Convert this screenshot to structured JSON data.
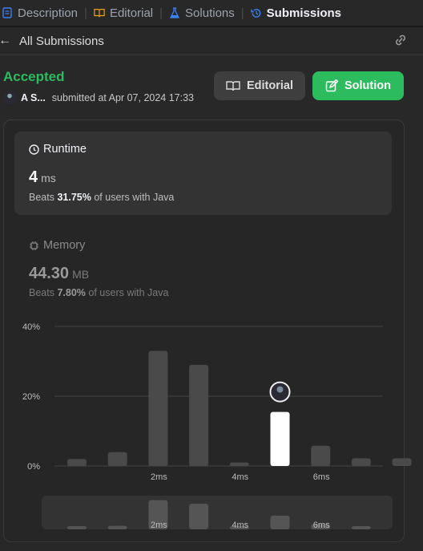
{
  "tabs": [
    {
      "label": "Description",
      "icon": "description-icon"
    },
    {
      "label": "Editorial",
      "icon": "book-icon"
    },
    {
      "label": "Solutions",
      "icon": "flask-icon"
    },
    {
      "label": "Submissions",
      "icon": "history-icon"
    }
  ],
  "subheader": {
    "back_label": "All Submissions"
  },
  "submission": {
    "status": "Accepted",
    "user": "A S...",
    "submitted_text": "submitted at Apr 07, 2024 17:33"
  },
  "buttons": {
    "editorial": "Editorial",
    "solution": "Solution"
  },
  "runtime": {
    "title": "Runtime",
    "value": "4",
    "unit": "ms",
    "beats_prefix": "Beats",
    "beats_pct": "31.75%",
    "beats_suffix": "of users with Java"
  },
  "memory": {
    "title": "Memory",
    "value": "44.30",
    "unit": "MB",
    "beats_prefix": "Beats",
    "beats_pct": "7.80%",
    "beats_suffix": "of users with Java"
  },
  "colors": {
    "accent_green": "#2cbb5d",
    "bar": "#4a4a4a",
    "highlight_bar": "#ffffff"
  },
  "chart_data": {
    "type": "bar",
    "y_ticks": [
      "40%",
      "20%",
      "0%"
    ],
    "x_tick_labels": [
      "2ms",
      "4ms",
      "6ms"
    ],
    "ylim": [
      0,
      40
    ],
    "values": [
      2,
      4,
      33,
      29,
      1,
      15.5,
      5.8,
      2.2,
      2.2
    ],
    "highlight_index": 5
  }
}
